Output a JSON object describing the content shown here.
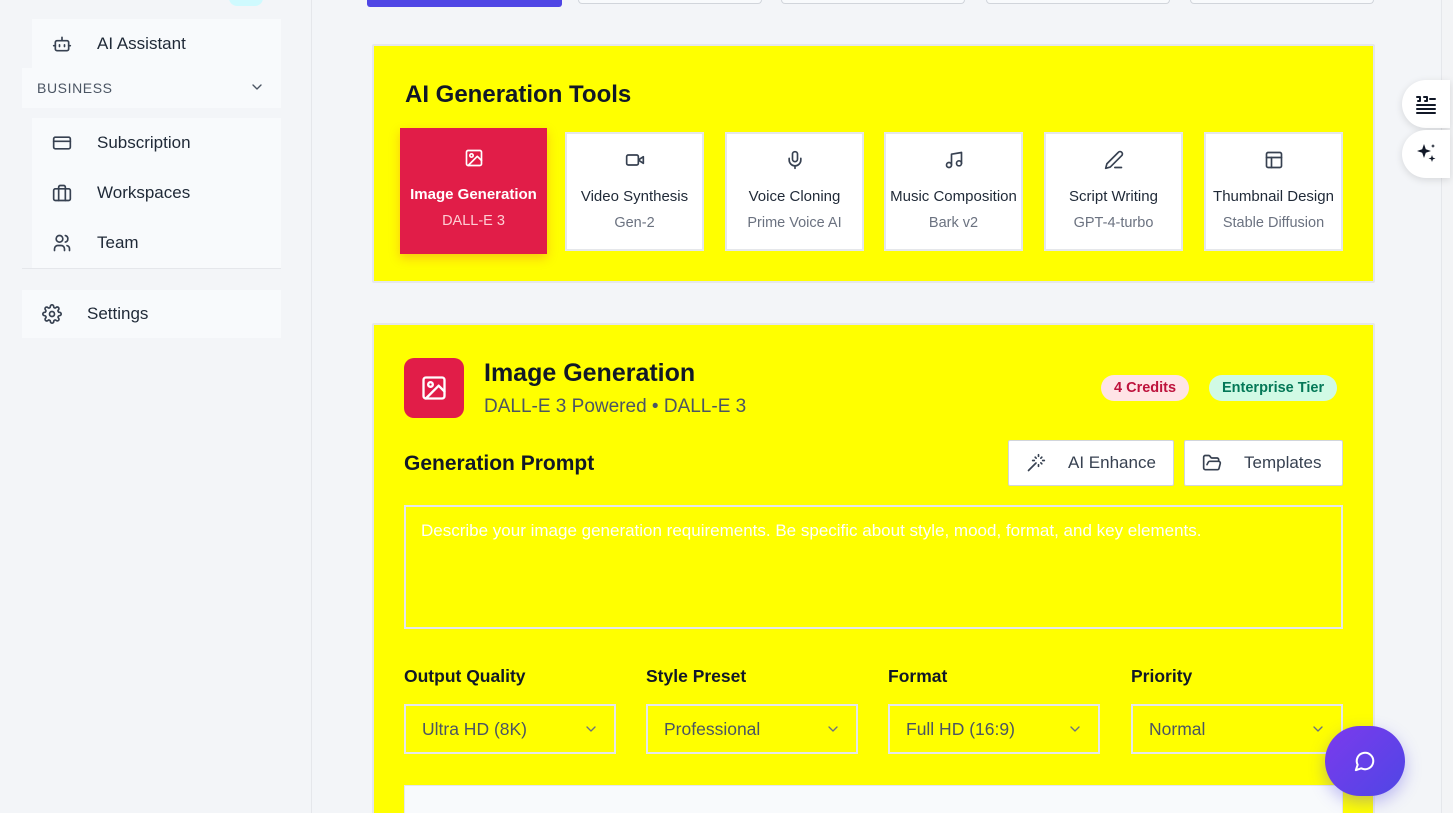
{
  "sidebar": {
    "items_top": [
      {
        "label": "AI Assistant",
        "icon": "bot-icon"
      }
    ],
    "section_business": "BUSINESS",
    "business_items": [
      {
        "label": "Subscription",
        "icon": "credit-card-icon"
      },
      {
        "label": "Workspaces",
        "icon": "briefcase-icon"
      },
      {
        "label": "Team",
        "icon": "users-icon"
      }
    ],
    "settings_label": "Settings"
  },
  "tools": {
    "title": "AI Generation Tools",
    "items": [
      {
        "name": "Image Generation",
        "model": "DALL-E 3",
        "icon": "image-icon",
        "active": true
      },
      {
        "name": "Video Synthesis",
        "model": "Gen-2",
        "icon": "video-icon"
      },
      {
        "name": "Voice Cloning",
        "model": "Prime Voice AI",
        "icon": "microphone-icon"
      },
      {
        "name": "Music Composition",
        "model": "Bark v2",
        "icon": "music-icon"
      },
      {
        "name": "Script Writing",
        "model": "GPT-4-turbo",
        "icon": "pencil-icon"
      },
      {
        "name": "Thumbnail Design",
        "model": "Stable Diffusion",
        "icon": "layout-icon"
      }
    ]
  },
  "generator": {
    "title": "Image Generation",
    "subtitle": "DALL-E 3 Powered • DALL-E 3",
    "credits_badge": "4 Credits",
    "tier_badge": "Enterprise Tier",
    "prompt_label": "Generation Prompt",
    "enhance_label": "AI Enhance",
    "templates_label": "Templates",
    "prompt_placeholder": "Describe your image generation requirements. Be specific about style, mood, format, and key elements.",
    "prompt_value": "",
    "options": [
      {
        "label": "Output Quality",
        "value": "Ultra HD (8K)"
      },
      {
        "label": "Style Preset",
        "value": "Professional"
      },
      {
        "label": "Format",
        "value": "Full HD (16:9)"
      },
      {
        "label": "Priority",
        "value": "Normal"
      }
    ]
  },
  "colors": {
    "accent": "#e11d48",
    "card_bg": "#ffff00",
    "tab_active": "#4f46e5"
  }
}
